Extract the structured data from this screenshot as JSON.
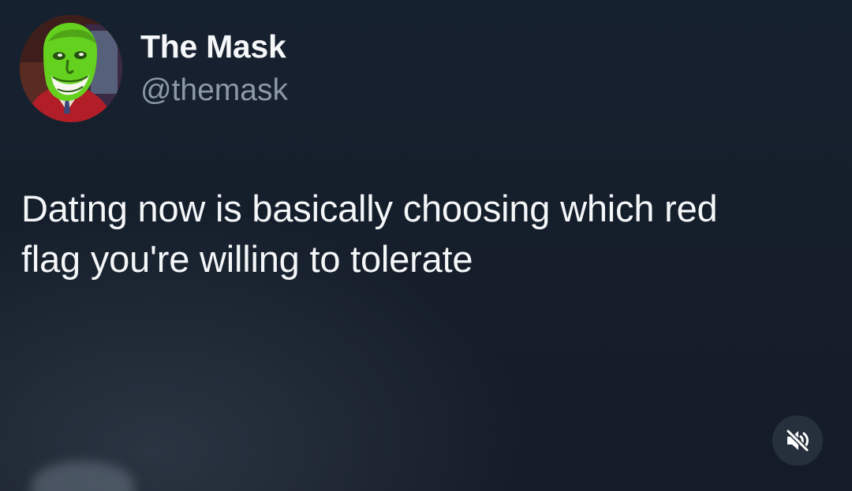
{
  "post": {
    "display_name": "The Mask",
    "handle": "@themask",
    "text_lines": [
      "Dating now is basically choosing which red",
      "flag you're willing to tolerate"
    ],
    "avatar_icon": "green-mask-face-avatar",
    "mute_icon": "speaker-muted-icon"
  },
  "colors": {
    "background": "#161f2b",
    "text": "#f4f6f8",
    "handle": "#8c99a6",
    "mute_button": "#26303c"
  }
}
